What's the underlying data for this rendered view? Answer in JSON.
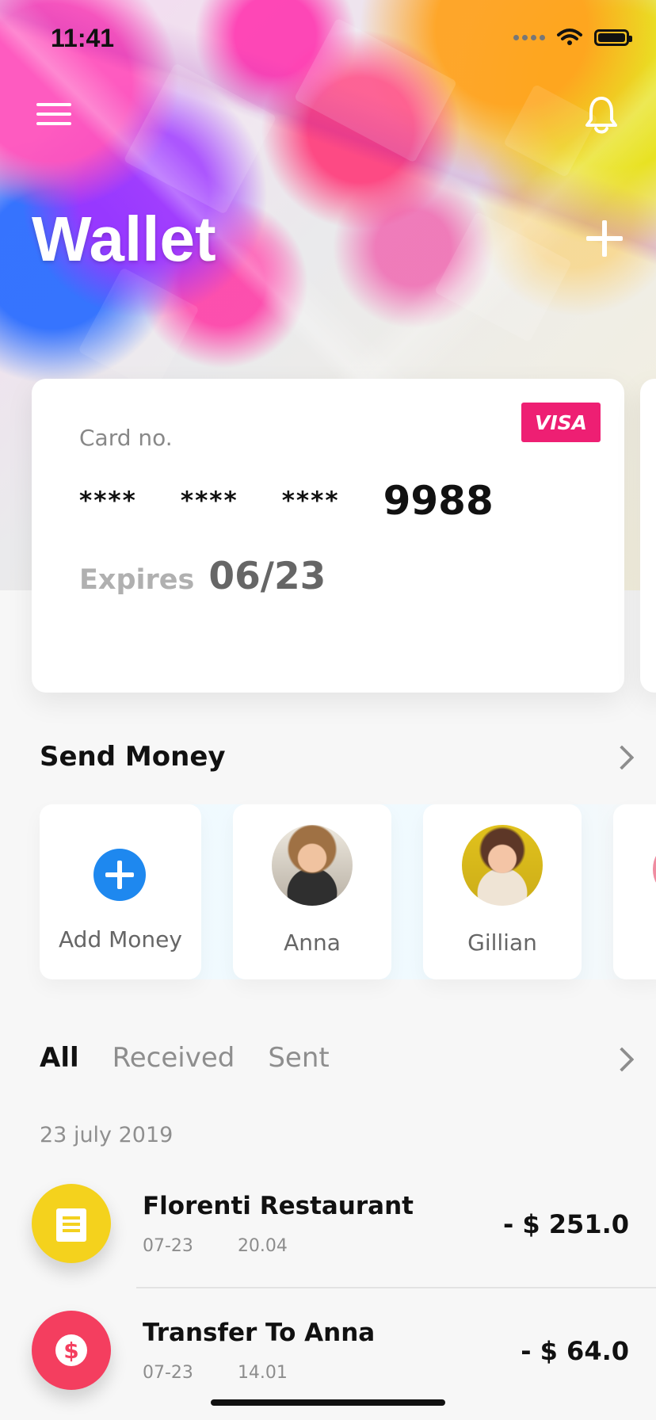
{
  "status_bar": {
    "time": "11:41"
  },
  "header": {
    "title": "Wallet"
  },
  "card": {
    "brand": "VISA",
    "label": "Card no.",
    "masked_groups": [
      "****",
      "****",
      "****"
    ],
    "last_four": "9988",
    "expires_label": "Expires",
    "expiry": "06/23"
  },
  "send_money": {
    "title": "Send Money",
    "items": [
      {
        "label": "Add Money"
      },
      {
        "label": "Anna"
      },
      {
        "label": "Gillian"
      }
    ]
  },
  "transactions": {
    "tabs": [
      "All",
      "Received",
      "Sent"
    ],
    "date_group": "23 july 2019",
    "items": [
      {
        "title": "Florenti Restaurant",
        "date": "07-23",
        "time": "20.04",
        "amount": "- $ 251.0"
      },
      {
        "title": "Transfer To Anna",
        "date": "07-23",
        "time": "14.01",
        "amount": "- $ 64.0"
      }
    ]
  },
  "colors": {
    "visa": "#ee1f73",
    "add_money": "#1e88ef",
    "restaurant": "#f4d21d",
    "transfer": "#f43e5f"
  },
  "icons": {
    "menu": "hamburger-icon",
    "notifications": "bell-icon",
    "add_card": "plus-icon",
    "more": "chevron-right-icon",
    "restaurant": "receipt-icon",
    "transfer": "dollar-icon"
  }
}
